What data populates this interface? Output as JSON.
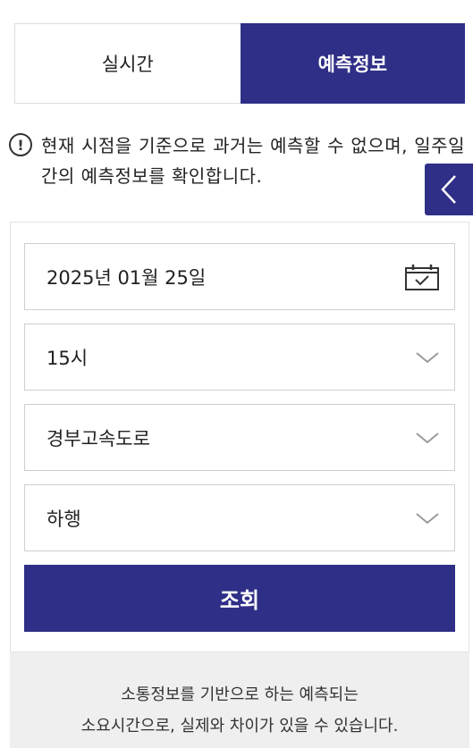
{
  "tabs": [
    {
      "label": "실시간",
      "active": false
    },
    {
      "label": "예측정보",
      "active": true
    }
  ],
  "notice": {
    "icon": "exclamation-circle-icon",
    "text": "현재 시점을 기준으로 과거는 예측할 수 없으며, 일주일간의 예측정보를 확인합니다."
  },
  "side_tab": {
    "icon": "chevron-left-icon"
  },
  "form": {
    "date": {
      "value": "2025년 01월 25일",
      "icon": "calendar-icon"
    },
    "hour": {
      "value": "15시",
      "icon": "chevron-down-icon"
    },
    "route": {
      "value": "경부고속도로",
      "icon": "chevron-down-icon"
    },
    "direction": {
      "value": "하행",
      "icon": "chevron-down-icon"
    },
    "search_label": "조회"
  },
  "footer": {
    "line1": "소통정보를 기반으로 하는 예측되는",
    "line2": "소요시간으로, 실제와 차이가 있을 수 있습니다."
  },
  "colors": {
    "accent": "#2f2f87",
    "border": "#cfcfcf",
    "footer_bg": "#efefef"
  }
}
